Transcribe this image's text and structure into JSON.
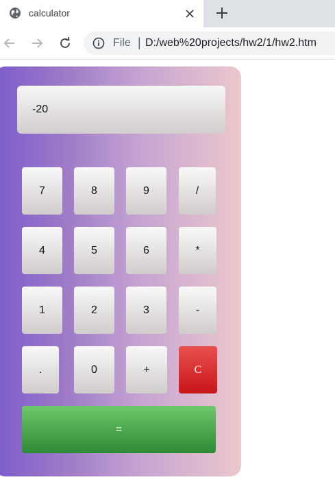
{
  "browser": {
    "tab": {
      "title": "calculator",
      "favicon": "globe-icon",
      "close_icon": "close-icon"
    },
    "new_tab_icon": "plus-icon",
    "toolbar": {
      "back_icon": "back-arrow-icon",
      "forward_icon": "forward-arrow-icon",
      "reload_icon": "reload-icon",
      "info_icon": "info-icon",
      "scheme_label": "File",
      "separator": "|",
      "url": "D:/web%20projects/hw2/1/hw2.htm"
    }
  },
  "calculator": {
    "display": "-20",
    "keys": {
      "seven": "7",
      "eight": "8",
      "nine": "9",
      "divide": "/",
      "four": "4",
      "five": "5",
      "six": "6",
      "multiply": "*",
      "one": "1",
      "two": "2",
      "three": "3",
      "minus": "-",
      "dot": ".",
      "zero": "0",
      "plus": "+",
      "clear": "C",
      "equals": "="
    },
    "colors": {
      "gradient_start": "#7b5ccb",
      "gradient_end": "#ecc8cb",
      "clear_key": "#d62025",
      "equals_key": "#4caf50"
    }
  }
}
